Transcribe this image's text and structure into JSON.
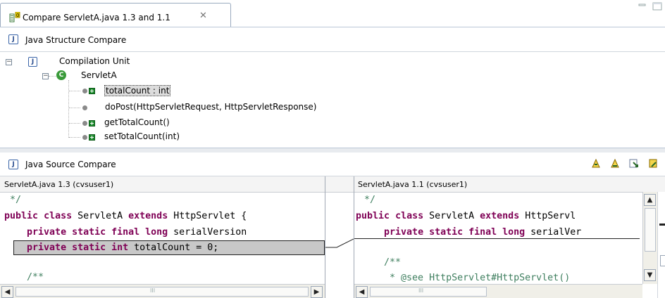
{
  "editor_tab": {
    "title": "Compare ServletA.java 1.3 and 1.1",
    "close_glyph": "✕"
  },
  "structure": {
    "header": "Java Structure Compare",
    "root": "Compilation Unit",
    "class": "ServletA",
    "class_badge": "C",
    "members": [
      {
        "label": "totalCount : int",
        "selected": true,
        "added": true
      },
      {
        "label": "doPost(HttpServletRequest, HttpServletResponse)",
        "selected": false,
        "added": false
      },
      {
        "label": "getTotalCount()",
        "selected": false,
        "added": true
      },
      {
        "label": "setTotalCount(int)",
        "selected": false,
        "added": true
      }
    ]
  },
  "source": {
    "header": "Java Source Compare",
    "left": {
      "title": "ServletA.java 1.3 (cvsuser1)",
      "lines": {
        "l1": " */",
        "l2a": "public",
        "l2b": " ",
        "l2c": "class",
        "l2d": " ServletA ",
        "l2e": "extends",
        "l2f": " HttpServlet {",
        "l3a": "    ",
        "l3b": "private static final long",
        "l3c": " serialVersion",
        "l4a": "    ",
        "l4b": "private static int",
        "l4c": " totalCount = 0;",
        "l5": "    /**"
      }
    },
    "right": {
      "title": "ServletA.java 1.1 (cvsuser1)",
      "lines": {
        "l1": " */",
        "l2a": "public",
        "l2c": "class",
        "l2d": " ServletA ",
        "l2e": "extends",
        "l2f": " HttpServl",
        "l3a": "    ",
        "l3b": "private static final long",
        "l3c": " serialVer",
        "l4": "    /**",
        "l5": "     * @see HttpServlet#HttpServlet()"
      }
    },
    "scroll_thumb_glyph": "III"
  },
  "colors": {
    "selection": "#c8c8c8",
    "keyword": "#7f0055",
    "comment": "#3f7f5f",
    "added": "#1d8a2d"
  }
}
